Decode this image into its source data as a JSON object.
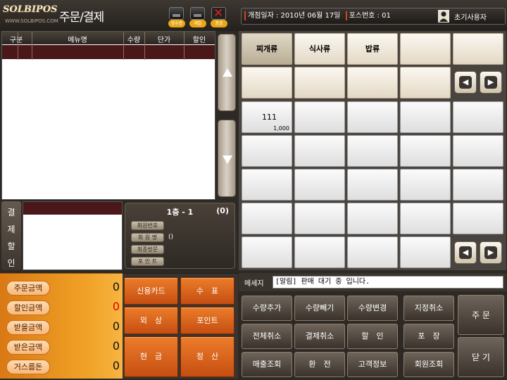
{
  "header": {
    "logo_text": "SOLBIPOS",
    "logo_url": "WWW.SOLBIPOS.COM",
    "title": "주문/결제",
    "icons": [
      {
        "name": "printer-icon",
        "label": "영수증"
      },
      {
        "name": "printer-icon",
        "label": "재발"
      },
      {
        "name": "close-icon",
        "label": "종료"
      }
    ],
    "info": {
      "open_date_label": "개점일자 : 2010년 06월 17일",
      "pos_no_label": "포스번호 : 01",
      "user_icon": "user-icon",
      "user_label": "초기사용자"
    }
  },
  "order_table": {
    "columns": [
      "구분",
      "메뉴명",
      "수량",
      "단가",
      "할인"
    ]
  },
  "discount": {
    "vertical_label": [
      "결",
      "제",
      "할",
      "인"
    ]
  },
  "table_info": {
    "name": "1층 - 1",
    "count": "(0)",
    "fields": [
      "회원번호",
      "회 원 명",
      "최종방문",
      "포 인 트"
    ],
    "member_name_value": "()"
  },
  "totals": [
    {
      "label": "주문금액",
      "value": "0",
      "color": "#111111"
    },
    {
      "label": "할인금액",
      "value": "0",
      "color": "#e00000"
    },
    {
      "label": "받을금액",
      "value": "0",
      "color": "#111111"
    },
    {
      "label": "받은금액",
      "value": "0",
      "color": "#111111"
    },
    {
      "label": "거스름돈",
      "value": "0",
      "color": "#111111"
    }
  ],
  "payment_buttons": [
    "신용카드",
    "수　표",
    "외　상",
    "포인트",
    "현　금",
    "정　산"
  ],
  "categories": [
    "찌개류",
    "식사류",
    "밥류",
    "",
    "",
    "",
    "",
    "",
    "",
    ""
  ],
  "menu_items": [
    {
      "name": "111",
      "price": "1,000"
    }
  ],
  "message": {
    "label": "메세지",
    "text": "[알림] 판매 대기 중 입니다."
  },
  "functions": [
    "수량추가",
    "수량빼기",
    "수량변경",
    "지정취소",
    "전체취소",
    "결제취소",
    "할　인",
    "포　장",
    "매출조회",
    "환　전",
    "고객정보",
    "회원조회"
  ],
  "side_functions": [
    "주 문",
    "닫 기"
  ],
  "nav": {
    "prev": "◀",
    "next": "▶",
    "up": "▲",
    "down": "▼"
  },
  "colors": {
    "accent": "#f0a126",
    "pay_button": "#d45c1a",
    "header_row": "#4a1818"
  }
}
